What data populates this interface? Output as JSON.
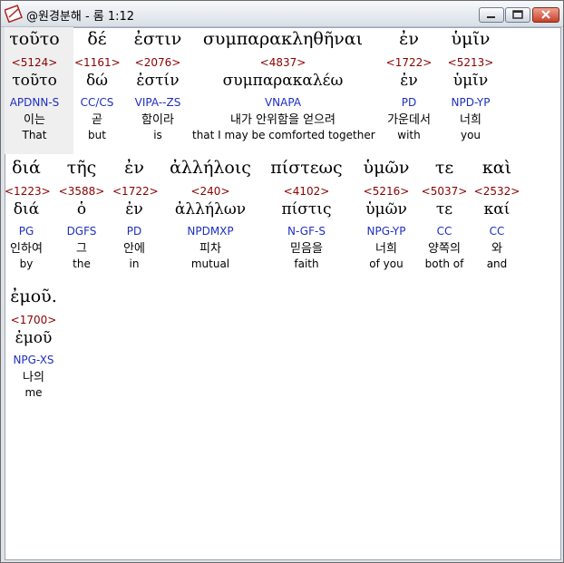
{
  "window": {
    "title": "@원경분해 - 롬 1:12",
    "icon": "bible-analysis-icon",
    "controls": [
      "minimize-icon",
      "maximize-icon",
      "close-icon"
    ]
  },
  "words": [
    {
      "greek": "τοῦτο",
      "strong": "<5124>",
      "lemma": "τοῦτο",
      "parse": "APDNN-S",
      "korean": "이는",
      "english": "That"
    },
    {
      "greek": "δέ",
      "strong": "<1161>",
      "lemma": "δώ",
      "parse": "CC/CS",
      "korean": "곧",
      "english": "but"
    },
    {
      "greek": "ἐστιν",
      "strong": "<2076>",
      "lemma": "ἐστίν",
      "parse": "VIPA--ZS",
      "korean": "함이라",
      "english": "is"
    },
    {
      "greek": "συμπαρακληθῆναι",
      "strong": "<4837>",
      "lemma": "συμπαρακαλέω",
      "parse": "VNAPA",
      "korean": "내가 안위함을 얻으려",
      "english": "that I may be comforted together"
    },
    {
      "greek": "ἐν",
      "strong": "<1722>",
      "lemma": "ἐν",
      "parse": "PD",
      "korean": "가운데서",
      "english": "with"
    },
    {
      "greek": "ὑμῖν",
      "strong": "<5213>",
      "lemma": "ὑμῖν",
      "parse": "NPD-YP",
      "korean": "너희",
      "english": "you"
    },
    {
      "greek": "διά",
      "strong": "<1223>",
      "lemma": "διά",
      "parse": "PG",
      "korean": "인하여",
      "english": "by"
    },
    {
      "greek": "τῆς",
      "strong": "<3588>",
      "lemma": "ὁ",
      "parse": "DGFS",
      "korean": "그",
      "english": "the"
    },
    {
      "greek": "ἐν",
      "strong": "<1722>",
      "lemma": "ἐν",
      "parse": "PD",
      "korean": "안에",
      "english": "in"
    },
    {
      "greek": "ἀλλήλοις",
      "strong": "<240>",
      "lemma": "ἀλλήλων",
      "parse": "NPDMXP",
      "korean": "피차",
      "english": "mutual"
    },
    {
      "greek": "πίστεως",
      "strong": "<4102>",
      "lemma": "πίστις",
      "parse": "N-GF-S",
      "korean": "믿음을",
      "english": "faith"
    },
    {
      "greek": "ὑμῶν",
      "strong": "<5216>",
      "lemma": "ὑμῶν",
      "parse": "NPG-YP",
      "korean": "너희",
      "english": "of you"
    },
    {
      "greek": "τε",
      "strong": "<5037>",
      "lemma": "τε",
      "parse": "CC",
      "korean": "양쪽의",
      "english": "both of"
    },
    {
      "greek": "καὶ",
      "strong": "<2532>",
      "lemma": "καί",
      "parse": "CC",
      "korean": "와",
      "english": "and"
    },
    {
      "greek": "ἐμοῦ.",
      "strong": "<1700>",
      "lemma": "ἐμοῦ",
      "parse": "NPG-XS",
      "korean": "나의",
      "english": "me"
    }
  ]
}
